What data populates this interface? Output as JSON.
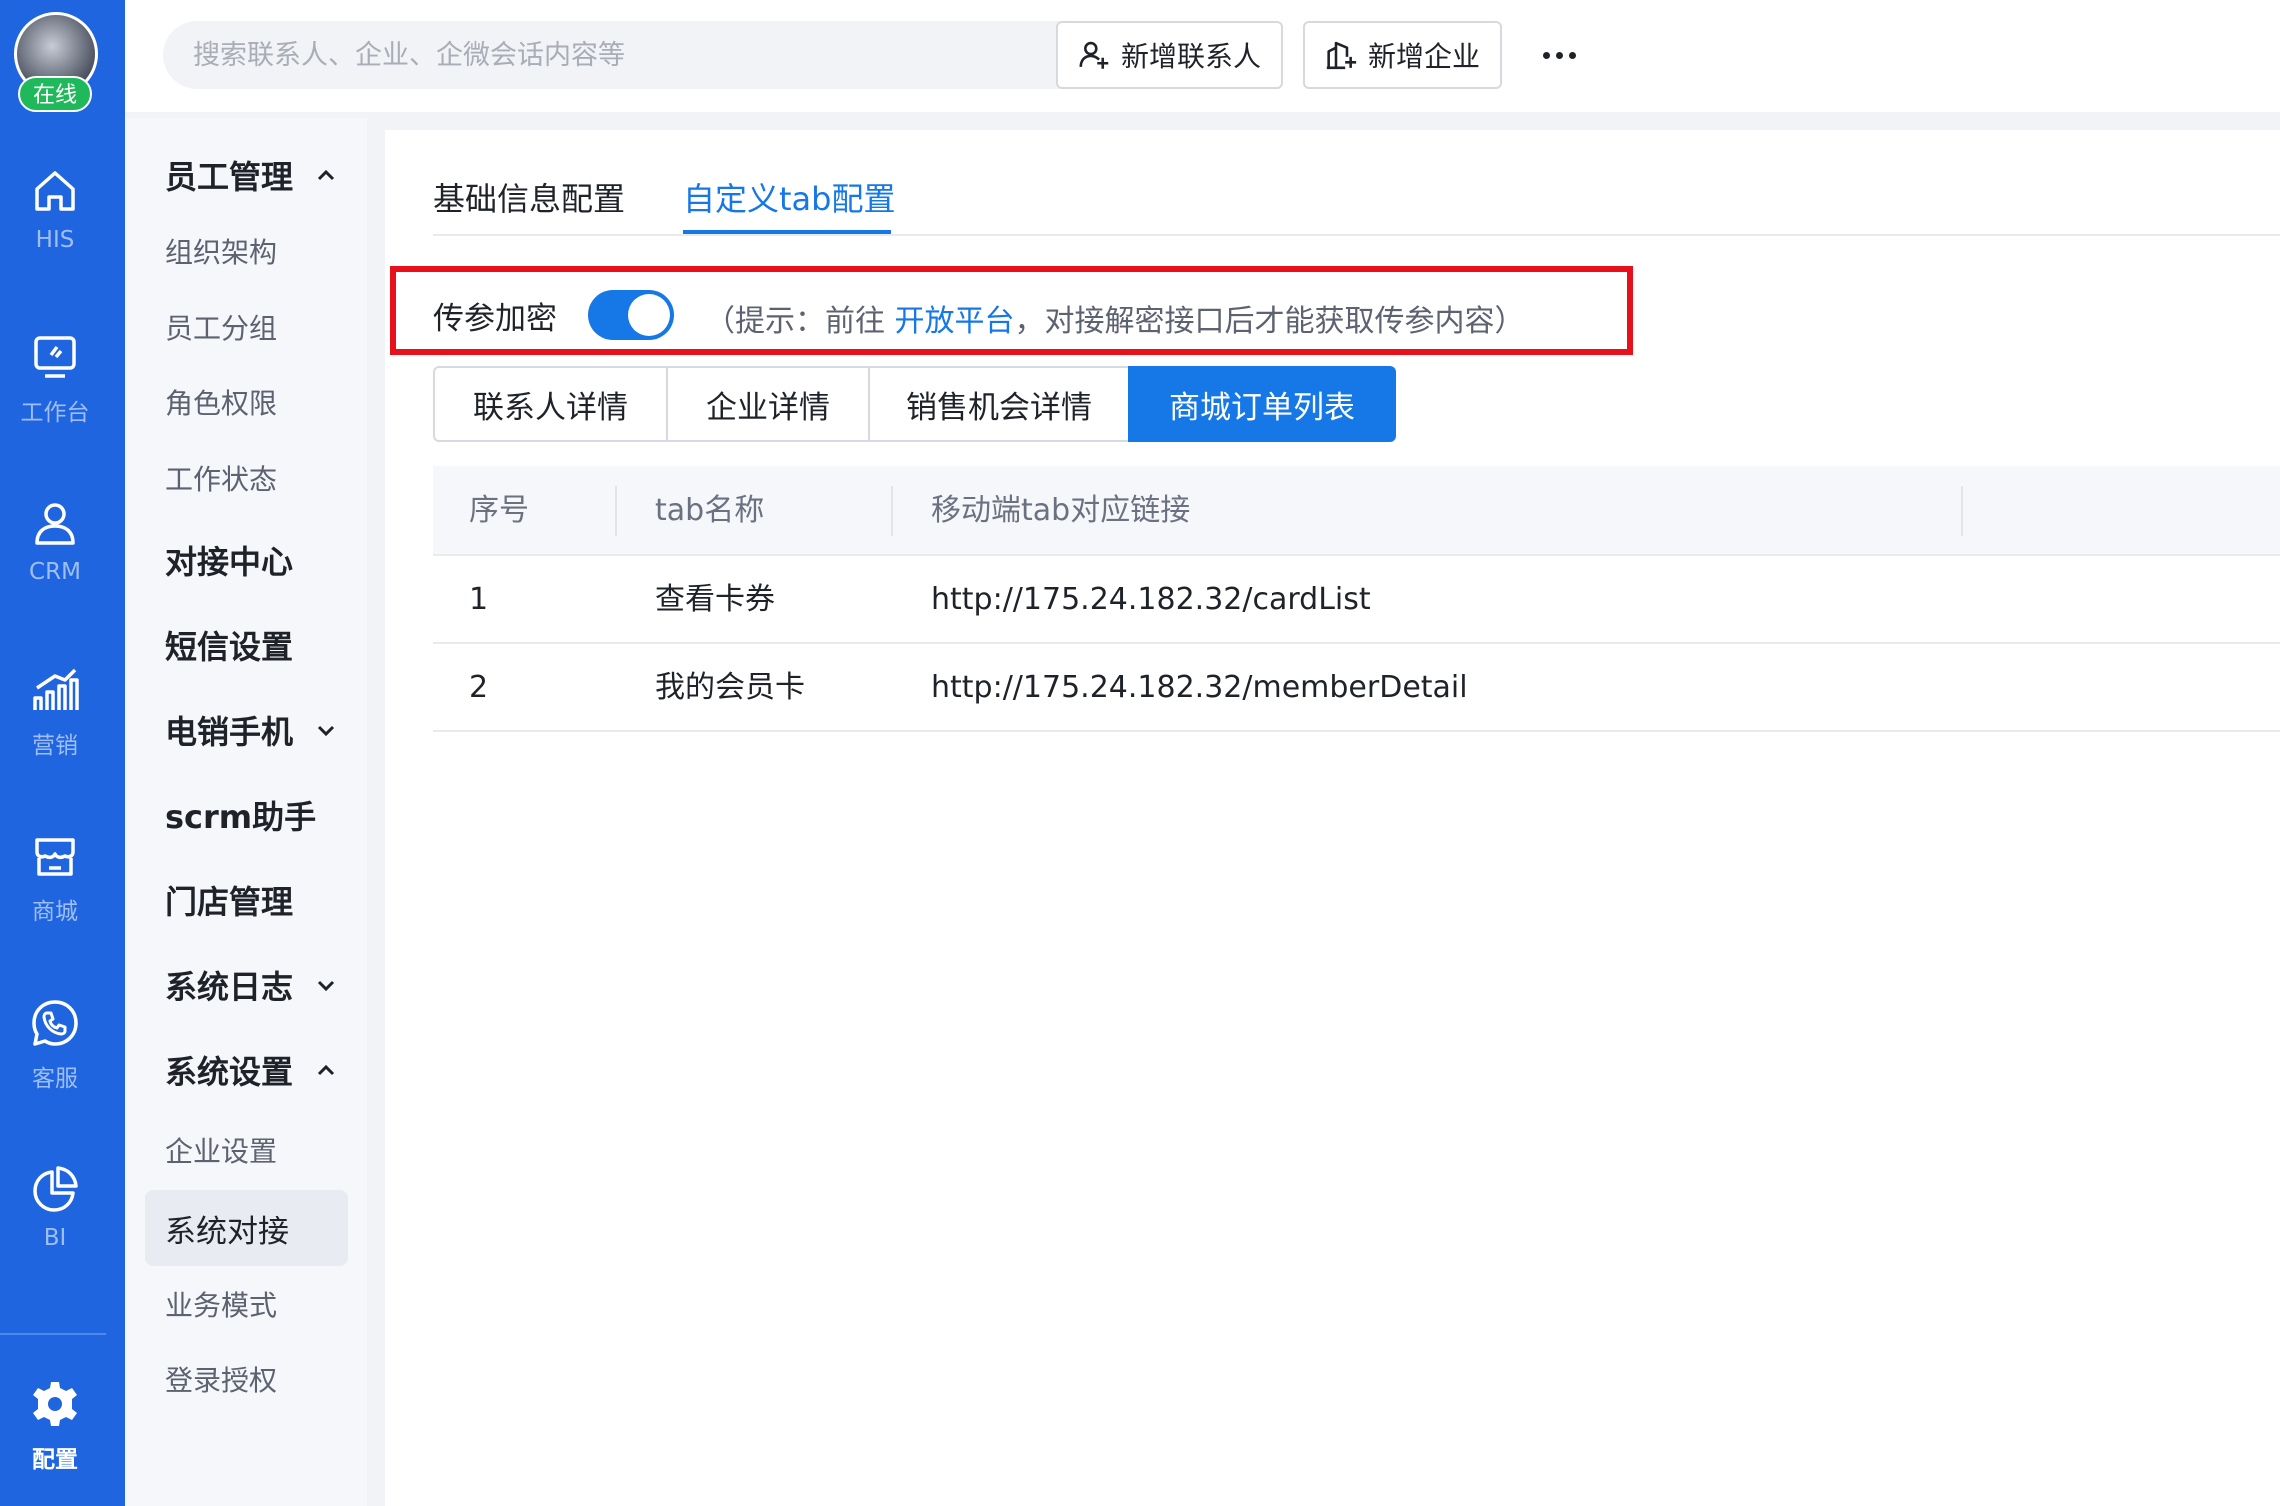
{
  "rail": {
    "status": "在线",
    "items": [
      {
        "label": "HIS",
        "icon": "home-icon"
      },
      {
        "label": "工作台",
        "icon": "monitor-icon"
      },
      {
        "label": "CRM",
        "icon": "person-icon"
      },
      {
        "label": "营销",
        "icon": "growth-chart-icon"
      },
      {
        "label": "商城",
        "icon": "store-icon"
      },
      {
        "label": "客服",
        "icon": "phone-chat-icon"
      },
      {
        "label": "BI",
        "icon": "pie-chart-icon"
      },
      {
        "label": "配置",
        "icon": "gear-icon"
      }
    ]
  },
  "topbar": {
    "search_placeholder": "搜索联系人、企业、企微会话内容等",
    "add_contact": "新增联系人",
    "add_company": "新增企业"
  },
  "sidebar": {
    "items": [
      {
        "label": "员工管理",
        "type": "group",
        "chevron": "up"
      },
      {
        "label": "组织架构",
        "type": "sub"
      },
      {
        "label": "员工分组",
        "type": "sub"
      },
      {
        "label": "角色权限",
        "type": "sub"
      },
      {
        "label": "工作状态",
        "type": "sub"
      },
      {
        "label": "对接中心",
        "type": "group"
      },
      {
        "label": "短信设置",
        "type": "group"
      },
      {
        "label": "电销手机",
        "type": "group",
        "chevron": "down"
      },
      {
        "label": "scrm助手",
        "type": "group"
      },
      {
        "label": "门店管理",
        "type": "group"
      },
      {
        "label": "系统日志",
        "type": "group",
        "chevron": "down"
      },
      {
        "label": "系统设置",
        "type": "group",
        "chevron": "up"
      },
      {
        "label": "企业设置",
        "type": "sub"
      },
      {
        "label": "系统对接",
        "type": "sub",
        "selected": true
      },
      {
        "label": "业务模式",
        "type": "sub"
      },
      {
        "label": "登录授权",
        "type": "sub"
      }
    ]
  },
  "main": {
    "tabs": [
      {
        "label": "基础信息配置"
      },
      {
        "label": "自定义tab配置",
        "active": true
      }
    ],
    "encryption": {
      "label": "传参加密",
      "enabled": true,
      "hint_prefix": "（提示：前往 ",
      "hint_link": "开放平台",
      "hint_suffix": "，对接解密接口后才能获取传参内容）"
    },
    "segments": [
      {
        "label": "联系人详情"
      },
      {
        "label": "企业详情"
      },
      {
        "label": "销售机会详情"
      },
      {
        "label": "商城订单列表",
        "active": true
      }
    ],
    "table": {
      "headers": [
        "序号",
        "tab名称",
        "移动端tab对应链接"
      ],
      "rows": [
        [
          "1",
          "查看卡券",
          "http://175.24.182.32/cardList"
        ],
        [
          "2",
          "我的会员卡",
          "http://175.24.182.32/memberDetail"
        ]
      ]
    }
  },
  "colors": {
    "rail": "#2065e0",
    "accent": "#1677e6",
    "highlight": "#e8101b",
    "online": "#1fb85a"
  }
}
